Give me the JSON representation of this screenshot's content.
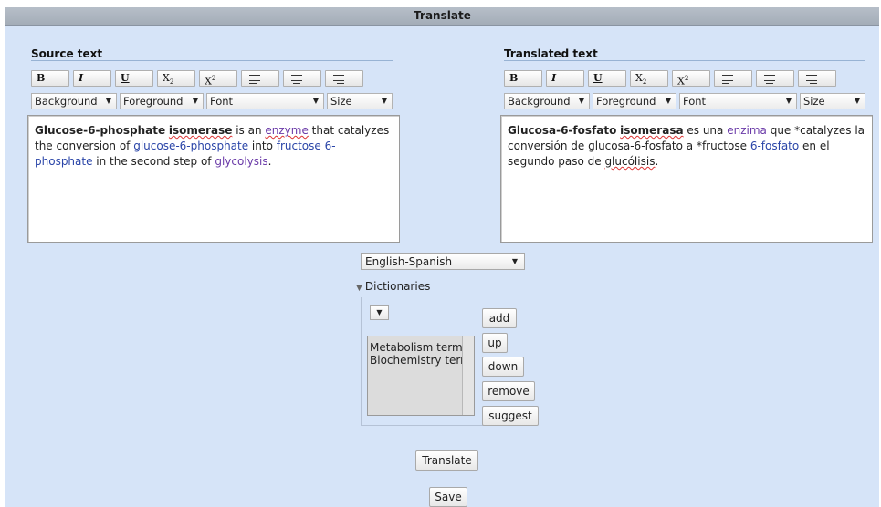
{
  "window": {
    "title": "Translate"
  },
  "source": {
    "title": "Source text",
    "toolbar": {
      "bold": "B",
      "italic": "I",
      "underline": "U",
      "subscript_base": "X",
      "subscript_mark": "2",
      "superscript_base": "X",
      "superscript_mark": "2"
    },
    "dropdowns": {
      "background": "Background",
      "foreground": "Foreground",
      "font": "Font",
      "size": "Size"
    },
    "content": {
      "t1": "Glucose-6-phosphate",
      "t2": " ",
      "t3": "isomerase",
      "t4": " is an ",
      "t5": "enzyme",
      "t6": " that catalyzes the conversion of ",
      "t7": "glucose-6-phosphate",
      "t8": " into ",
      "t9": "fructose 6-phosphate",
      "t10": " in the second step of ",
      "t11": "glycolysis",
      "t12": "."
    }
  },
  "target": {
    "title": "Translated text",
    "toolbar": {
      "bold": "B",
      "italic": "I",
      "underline": "U",
      "subscript_base": "X",
      "subscript_mark": "2",
      "superscript_base": "X",
      "superscript_mark": "2"
    },
    "dropdowns": {
      "background": "Background",
      "foreground": "Foreground",
      "font": "Font",
      "size": "Size"
    },
    "content": {
      "t1": "Glucosa-6-fosfato",
      "t2": " ",
      "t3": "isomerasa",
      "t4": " es una ",
      "t5": "enzima",
      "t6": " que *catalyzes la conversión de glucosa-6-fosfato  a *fructose ",
      "t7": "6-fosfato",
      "t8": " en el segundo paso de ",
      "t9": "glucólisis",
      "t10": "."
    }
  },
  "language_pair": {
    "selected": "English-Spanish"
  },
  "dictionaries": {
    "label": "Dictionaries",
    "list": [
      "Metabolism termi",
      "Biochemistry terr"
    ],
    "buttons": {
      "add": "add",
      "up": "up",
      "down": "down",
      "remove": "remove",
      "suggest": "suggest"
    }
  },
  "actions": {
    "translate": "Translate",
    "save": "Save"
  },
  "colors": {
    "panel_bg": "#d6e4f8",
    "link": "#2a45a8",
    "visited_link": "#6a3aa8",
    "titlebar": "#a4adb8"
  }
}
